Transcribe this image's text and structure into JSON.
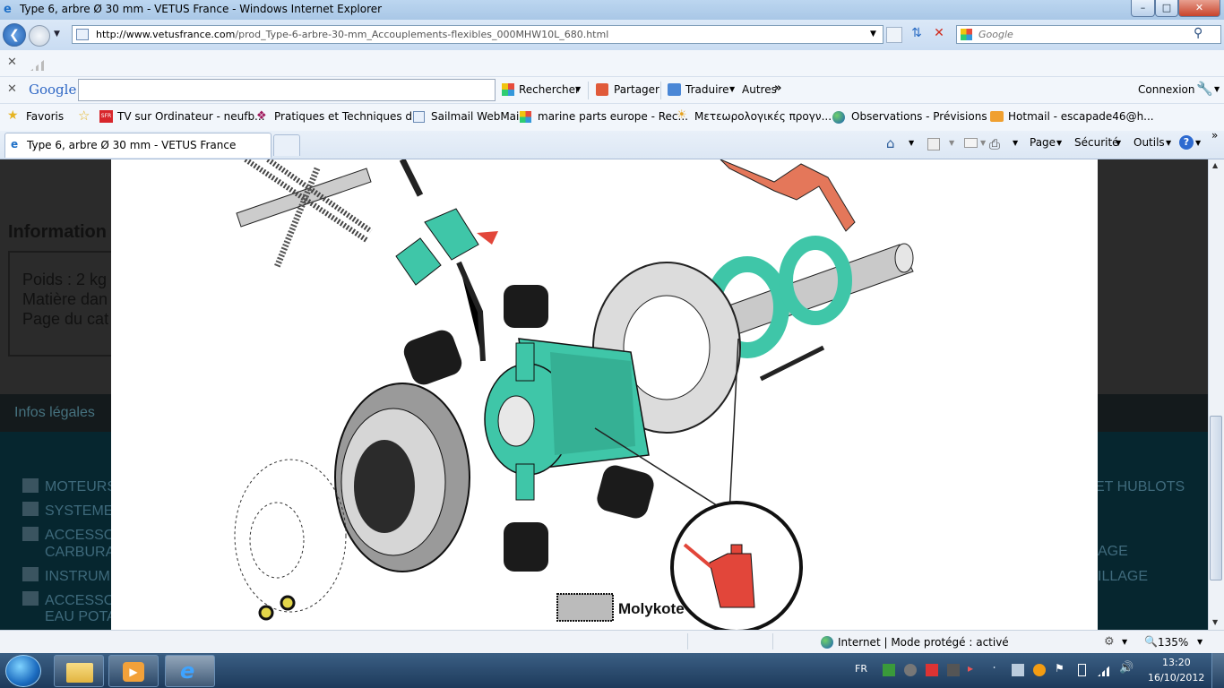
{
  "window": {
    "title": "Type 6, arbre Ø 30 mm - VETUS France - Windows Internet Explorer"
  },
  "nav": {
    "url_domain": "http://www.vetusfrance.com",
    "url_path": "/prod_Type-6-arbre-30-mm_Accouplements-flexibles_000MHW10L_680.html",
    "search_placeholder": "Google"
  },
  "google_toolbar": {
    "logo": "Google",
    "search_label": "Rechercher",
    "share_label": "Partager",
    "translate_label": "Traduire",
    "more_label": "Autres",
    "login_label": "Connexion"
  },
  "favorites": {
    "label": "Favoris",
    "items": [
      "TV sur Ordinateur - neufb...",
      "Pratiques et Techniques d...",
      "Sailmail WebMail",
      "marine parts europe - Rec...",
      "Μετεωρολογικές προγν...",
      "Observations - Prévisions ...",
      "Hotmail - escapade46@h..."
    ]
  },
  "tabs": {
    "active": "Type 6, arbre Ø 30 mm - VETUS France",
    "commands": {
      "page": "Page",
      "security": "Sécurité",
      "tools": "Outils"
    }
  },
  "page": {
    "info_heading": "Information",
    "info_lines": [
      "Poids : 2 kg",
      "Matière dan",
      "Page du cat"
    ],
    "legal_link": "Infos légales",
    "categories_left": [
      "MOTEURS",
      "SYSTEME",
      "ACCESSO",
      "CARBURA",
      "INSTRUM",
      "ACCESSO",
      "EAU POTA"
    ],
    "categories_right": [
      "ET HUBLOTS",
      "AGE",
      "ILLAGE"
    ],
    "image_label": "Molykote"
  },
  "status": {
    "zone": "Internet | Mode protégé : activé",
    "zoom": "135%"
  },
  "taskbar": {
    "language": "FR",
    "time": "13:20",
    "date": "16/10/2012"
  },
  "colors": {
    "teal_part": "#3fc6a8",
    "orange_part": "#e4775a",
    "oil_can": "#e2463a",
    "page_dark": "#2b2b2b"
  }
}
